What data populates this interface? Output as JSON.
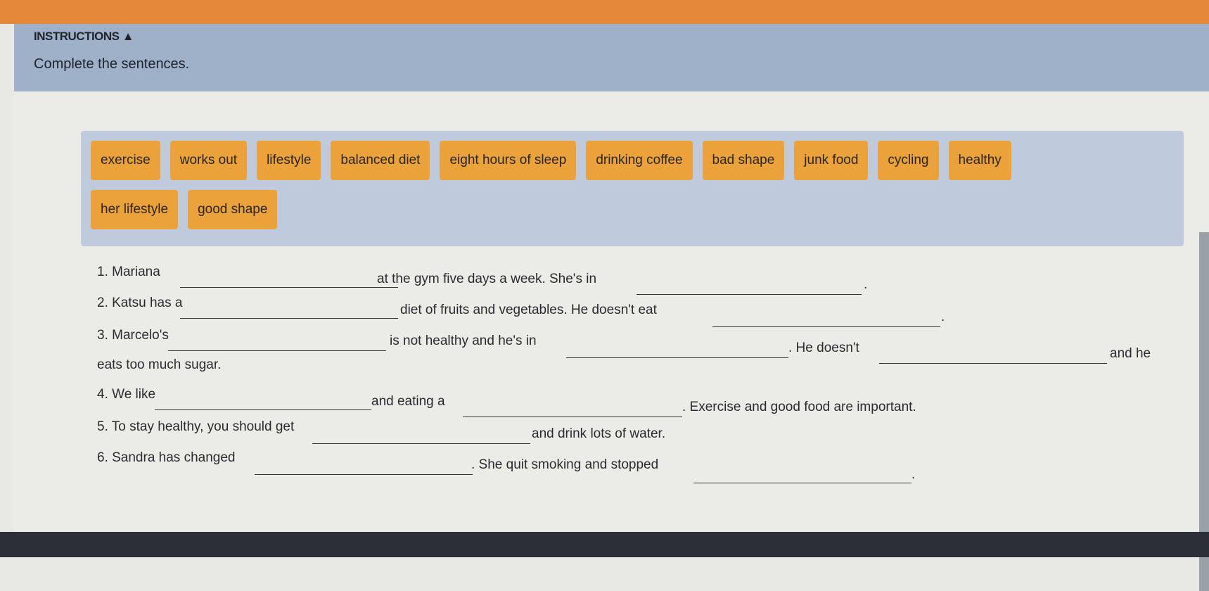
{
  "instructions": {
    "title": "INSTRUCTIONS ▲",
    "text": "Complete the sentences."
  },
  "word_bank": {
    "row1": [
      "exercise",
      "works out",
      "lifestyle",
      "balanced diet",
      "eight hours of sleep",
      "drinking coffee",
      "bad shape",
      "junk food",
      "cycling",
      "healthy"
    ],
    "row2": [
      "her lifestyle",
      "good shape"
    ]
  },
  "sentences": [
    {
      "parts": [
        "1. Mariana",
        "at the gym five days a week. She's in",
        "."
      ]
    },
    {
      "parts": [
        "2. Katsu has a",
        "diet of fruits and vegetables. He doesn't eat",
        "."
      ]
    },
    {
      "parts": [
        "3. Marcelo's",
        "is not healthy and he's in",
        ". He doesn't",
        "and he",
        "eats too much sugar."
      ]
    },
    {
      "parts": [
        "4. We like",
        "and eating a",
        ". Exercise and good food are important."
      ]
    },
    {
      "parts": [
        "5. To stay healthy, you should get",
        "and drink lots of water."
      ]
    },
    {
      "parts": [
        "6. Sandra has changed",
        ". She quit smoking and stopped",
        "."
      ]
    }
  ],
  "colors": {
    "header": "#e4893a",
    "instructions_band": "#9fb0c9",
    "chip": "#eba23a",
    "bank": "#bfcbdd"
  }
}
